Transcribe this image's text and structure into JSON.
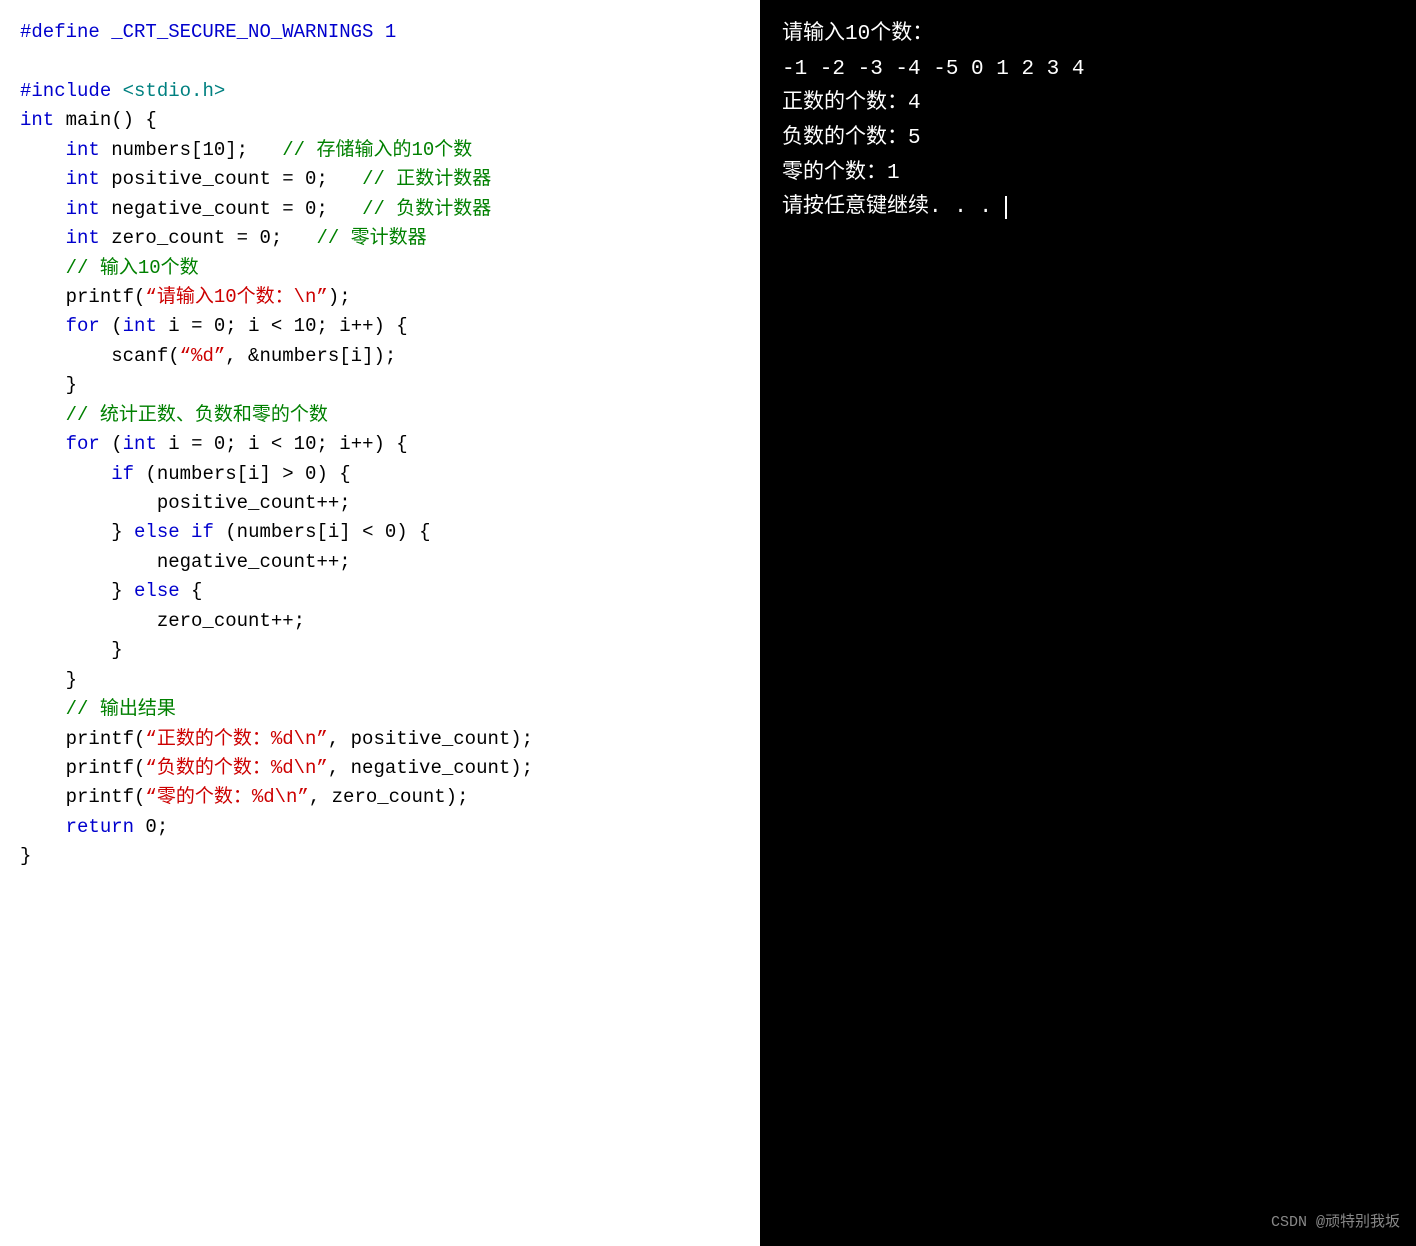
{
  "code_panel": {
    "lines": [
      {
        "id": "line1",
        "parts": [
          {
            "text": "#define _CRT_SECURE_NO_WARNINGS 1",
            "class": "c-blue"
          }
        ]
      },
      {
        "id": "line2",
        "parts": [
          {
            "text": "",
            "class": ""
          }
        ]
      },
      {
        "id": "line3",
        "parts": [
          {
            "text": "#include ",
            "class": "c-blue"
          },
          {
            "text": "<stdio.h>",
            "class": "c-teal"
          }
        ]
      },
      {
        "id": "line4",
        "parts": [
          {
            "text": "int",
            "class": "c-blue"
          },
          {
            "text": " main() {",
            "class": "c-black"
          }
        ]
      },
      {
        "id": "line5",
        "parts": [
          {
            "text": "    ",
            "class": ""
          },
          {
            "text": "int",
            "class": "c-blue"
          },
          {
            "text": " numbers[10];   ",
            "class": "c-black"
          },
          {
            "text": "// 存储输入的10个数",
            "class": "c-green"
          }
        ]
      },
      {
        "id": "line6",
        "parts": [
          {
            "text": "    ",
            "class": ""
          },
          {
            "text": "int",
            "class": "c-blue"
          },
          {
            "text": " positive_count = 0;   ",
            "class": "c-black"
          },
          {
            "text": "// 正数计数器",
            "class": "c-green"
          }
        ]
      },
      {
        "id": "line7",
        "parts": [
          {
            "text": "    ",
            "class": ""
          },
          {
            "text": "int",
            "class": "c-blue"
          },
          {
            "text": " negative_count = 0;   ",
            "class": "c-black"
          },
          {
            "text": "// 负数计数器",
            "class": "c-green"
          }
        ]
      },
      {
        "id": "line8",
        "parts": [
          {
            "text": "    ",
            "class": ""
          },
          {
            "text": "int",
            "class": "c-blue"
          },
          {
            "text": " zero_count = 0;   ",
            "class": "c-black"
          },
          {
            "text": "// 零计数器",
            "class": "c-green"
          }
        ]
      },
      {
        "id": "line9",
        "parts": [
          {
            "text": "    ",
            "class": ""
          },
          {
            "text": "// 输入10个数",
            "class": "c-green"
          }
        ]
      },
      {
        "id": "line10",
        "parts": [
          {
            "text": "    printf(",
            "class": "c-black"
          },
          {
            "text": "“请输入10个数：\\n”",
            "class": "c-red"
          },
          {
            "text": ");",
            "class": "c-black"
          }
        ]
      },
      {
        "id": "line11",
        "parts": [
          {
            "text": "    ",
            "class": ""
          },
          {
            "text": "for",
            "class": "c-blue"
          },
          {
            "text": " (",
            "class": "c-black"
          },
          {
            "text": "int",
            "class": "c-blue"
          },
          {
            "text": " i = 0; i < 10; i++) {",
            "class": "c-black"
          }
        ]
      },
      {
        "id": "line12",
        "parts": [
          {
            "text": "        scanf(",
            "class": "c-black"
          },
          {
            "text": "“%d”",
            "class": "c-red"
          },
          {
            "text": ", &numbers[i]);",
            "class": "c-black"
          }
        ]
      },
      {
        "id": "line13",
        "parts": [
          {
            "text": "    }",
            "class": "c-black"
          }
        ]
      },
      {
        "id": "line14",
        "parts": [
          {
            "text": "    ",
            "class": ""
          },
          {
            "text": "// 统计正数、负数和零的个数",
            "class": "c-green"
          }
        ]
      },
      {
        "id": "line15",
        "parts": [
          {
            "text": "    ",
            "class": ""
          },
          {
            "text": "for",
            "class": "c-blue"
          },
          {
            "text": " (",
            "class": "c-black"
          },
          {
            "text": "int",
            "class": "c-blue"
          },
          {
            "text": " i = 0; i < 10; i++) {",
            "class": "c-black"
          }
        ]
      },
      {
        "id": "line16",
        "parts": [
          {
            "text": "        ",
            "class": ""
          },
          {
            "text": "if",
            "class": "c-blue"
          },
          {
            "text": " (numbers[i] > 0) {",
            "class": "c-black"
          }
        ]
      },
      {
        "id": "line17",
        "parts": [
          {
            "text": "            positive_count++;",
            "class": "c-black"
          }
        ]
      },
      {
        "id": "line18",
        "parts": [
          {
            "text": "        } ",
            "class": "c-black"
          },
          {
            "text": "else",
            "class": "c-blue"
          },
          {
            "text": " ",
            "class": ""
          },
          {
            "text": "if",
            "class": "c-blue"
          },
          {
            "text": " (numbers[i] < 0) {",
            "class": "c-black"
          }
        ]
      },
      {
        "id": "line19",
        "parts": [
          {
            "text": "            negative_count++;",
            "class": "c-black"
          }
        ]
      },
      {
        "id": "line20",
        "parts": [
          {
            "text": "        } ",
            "class": "c-black"
          },
          {
            "text": "else",
            "class": "c-blue"
          },
          {
            "text": " {",
            "class": "c-black"
          }
        ]
      },
      {
        "id": "line21",
        "parts": [
          {
            "text": "            zero_count++;",
            "class": "c-black"
          }
        ]
      },
      {
        "id": "line22",
        "parts": [
          {
            "text": "        }",
            "class": "c-black"
          }
        ]
      },
      {
        "id": "line23",
        "parts": [
          {
            "text": "    }",
            "class": "c-black"
          }
        ]
      },
      {
        "id": "line24",
        "parts": [
          {
            "text": "    ",
            "class": ""
          },
          {
            "text": "// 输出结果",
            "class": "c-green"
          }
        ]
      },
      {
        "id": "line25",
        "parts": [
          {
            "text": "    printf(",
            "class": "c-black"
          },
          {
            "text": "“正数的个数：%d\\n”",
            "class": "c-red"
          },
          {
            "text": ", positive_count);",
            "class": "c-black"
          }
        ]
      },
      {
        "id": "line26",
        "parts": [
          {
            "text": "    printf(",
            "class": "c-black"
          },
          {
            "text": "“负数的个数：%d\\n”",
            "class": "c-red"
          },
          {
            "text": ", negative_count);",
            "class": "c-black"
          }
        ]
      },
      {
        "id": "line27",
        "parts": [
          {
            "text": "    printf(",
            "class": "c-black"
          },
          {
            "text": "“零的个数：%d\\n”",
            "class": "c-red"
          },
          {
            "text": ", zero_count);",
            "class": "c-black"
          }
        ]
      },
      {
        "id": "line28",
        "parts": [
          {
            "text": "    ",
            "class": ""
          },
          {
            "text": "return",
            "class": "c-blue"
          },
          {
            "text": " 0;",
            "class": "c-black"
          }
        ]
      },
      {
        "id": "line29",
        "parts": [
          {
            "text": "}",
            "class": "c-black"
          }
        ]
      }
    ]
  },
  "terminal": {
    "prompt_line": "请输入10个数：",
    "input_line": "-1  -2  -3  -4  -5  0  1  2  3  4",
    "output": [
      "正数的个数：4",
      "负数的个数：5",
      "零的个数：1",
      "请按任意键继续. . ."
    ]
  },
  "watermark": "CSDN @顽特别我坂"
}
